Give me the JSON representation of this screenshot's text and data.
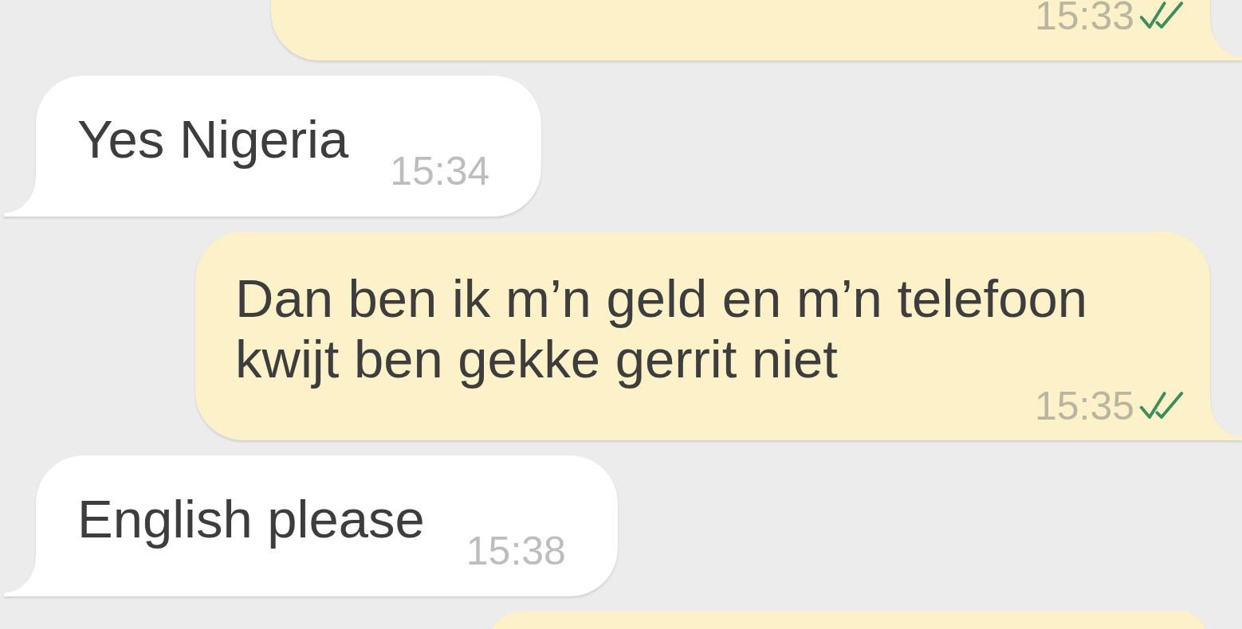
{
  "messages": [
    {
      "kind": "outgoing",
      "time": "15:33",
      "read": true
    },
    {
      "kind": "incoming",
      "text": "Yes Nigeria",
      "time": "15:34"
    },
    {
      "kind": "outgoing",
      "text": "Dan ben ik m’n geld en m’n telefoon kwijt ben gekke gerrit niet",
      "time": "15:35",
      "read": true
    },
    {
      "kind": "incoming",
      "text": "English please",
      "time": "15:38"
    },
    {
      "kind": "outgoing"
    }
  ]
}
